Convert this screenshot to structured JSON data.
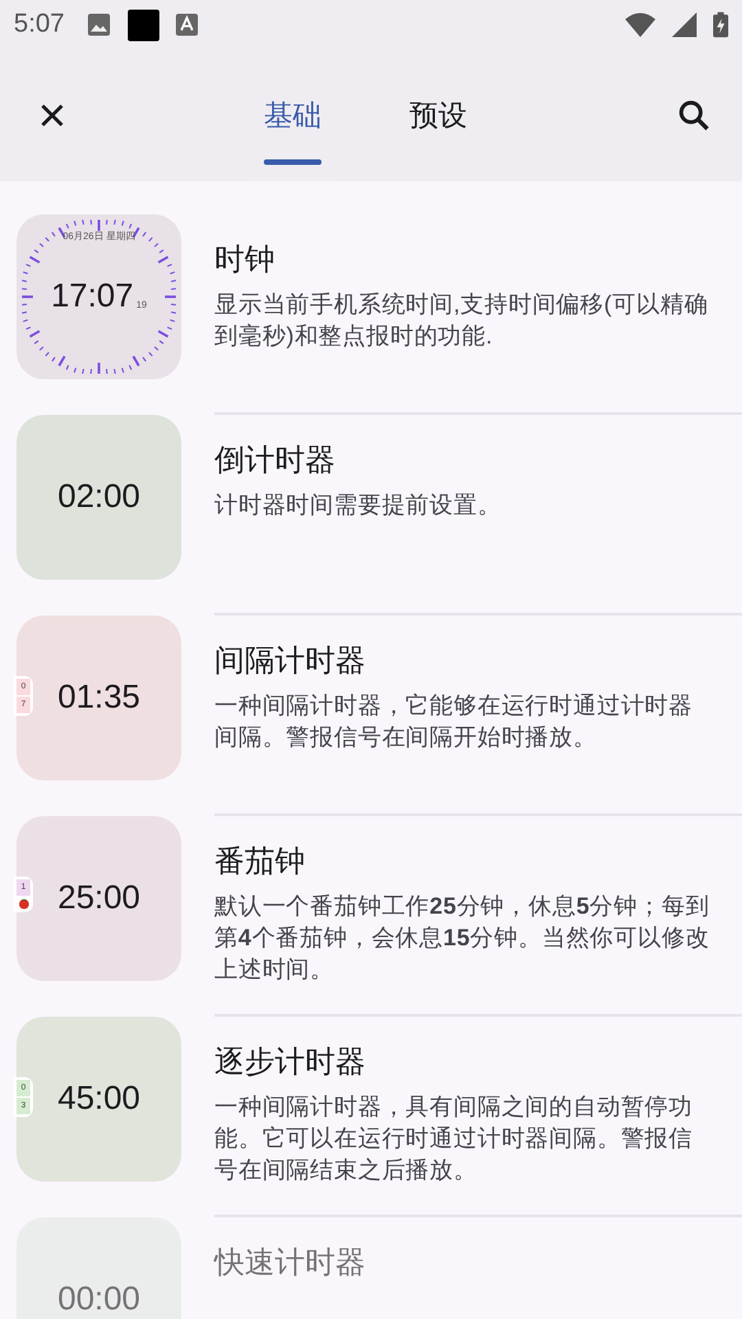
{
  "status_bar": {
    "time": "5:07"
  },
  "tabs": [
    {
      "label": "基础",
      "selected": true
    },
    {
      "label": "预设",
      "selected": false
    }
  ],
  "items": [
    {
      "kind": "clock",
      "title": "时钟",
      "description": "显示当前手机系统时间,支持时间偏移(可以精确到毫秒)和整点报时的功能.",
      "date": "06月26日 星期四",
      "time": "17:07",
      "seconds": "19",
      "faded": false
    },
    {
      "kind": "plain",
      "title": "倒计时器",
      "description": "计时器时间需要提前设置。",
      "time": "02:00",
      "faded": false
    },
    {
      "kind": "counter",
      "title": "间隔计时器",
      "description": "一种间隔计时器，它能够在运行时通过计时器间隔。警报信号在间隔开始时播放。",
      "time": "01:35",
      "badge": [
        "0",
        "7"
      ],
      "faded": false
    },
    {
      "kind": "tomato",
      "title": "番茄钟",
      "description": "默认一个番茄钟工作**25**分钟，休息**5**分钟；每到第**4**个番茄钟，会休息**15**分钟。当然你可以修改上述时间。",
      "time": "25:00",
      "badge": [
        "1"
      ],
      "faded": false
    },
    {
      "kind": "counter",
      "title": "逐步计时器",
      "description": "一种间隔计时器，具有间隔之间的自动暂停功能。它可以在运行时通过计时器间隔。警报信号在间隔结束之后播放。",
      "time": "45:00",
      "badge": [
        "0",
        "3"
      ],
      "faded": false
    },
    {
      "kind": "plain",
      "title": "快速计时器",
      "time": "00:00",
      "faded": true
    }
  ]
}
